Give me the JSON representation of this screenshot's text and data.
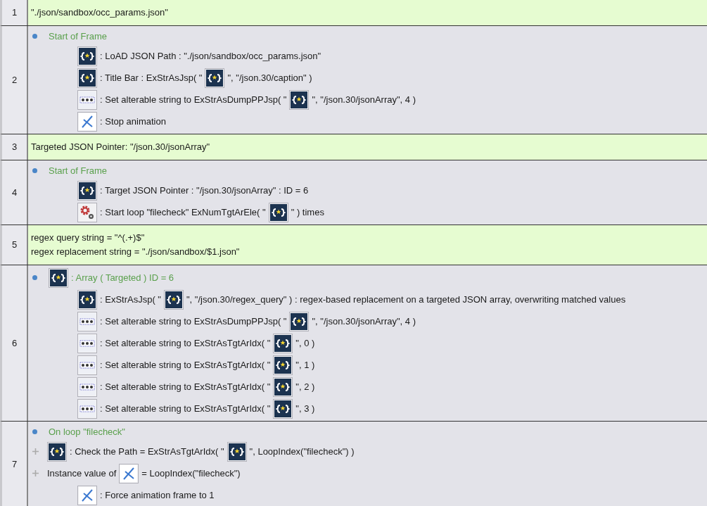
{
  "rows": [
    {
      "number": "1",
      "kind": "comment",
      "lines": [
        "\"./json/sandbox/occ_params.json\""
      ]
    },
    {
      "number": "2",
      "kind": "event",
      "conditions": [
        {
          "kind": "start",
          "segments": [
            {
              "text": "Start of Frame"
            }
          ]
        }
      ],
      "actions": [
        {
          "kind": "json",
          "segments": [
            {
              "text": ": LoAD JSON Path : \"./json/sandbox/occ_params.json\""
            }
          ]
        },
        {
          "kind": "json",
          "segments": [
            {
              "text": ": Title Bar : ExStrAsJsp( \""
            },
            {
              "kind": "json"
            },
            {
              "text": "\", \"/json.30/caption\" )"
            }
          ]
        },
        {
          "kind": "string",
          "segments": [
            {
              "text": ": Set alterable string to ExStrAsDumpPPJsp( \""
            },
            {
              "kind": "json"
            },
            {
              "text": "\", \"/json.30/jsonArray\", 4 )"
            }
          ]
        },
        {
          "kind": "animation",
          "segments": [
            {
              "text": ": Stop animation"
            }
          ]
        }
      ]
    },
    {
      "number": "3",
      "kind": "comment",
      "lines": [
        "Targeted JSON Pointer: \"/json.30/jsonArray\""
      ]
    },
    {
      "number": "4",
      "kind": "event",
      "conditions": [
        {
          "kind": "start",
          "segments": [
            {
              "text": "Start of Frame"
            }
          ]
        }
      ],
      "actions": [
        {
          "kind": "json",
          "segments": [
            {
              "text": ": Target JSON Pointer : \"/json.30/jsonArray\" : ID = 6"
            }
          ]
        },
        {
          "kind": "loop",
          "segments": [
            {
              "text": ": Start loop \"filecheck\" ExNumTgtArEle( \""
            },
            {
              "kind": "json"
            },
            {
              "text": "\" ) times"
            }
          ]
        }
      ]
    },
    {
      "number": "5",
      "kind": "comment",
      "lines": [
        "regex query string = \"^(.+)$\"",
        "regex replacement string = \"./json/sandbox/$1.json\""
      ]
    },
    {
      "number": "6",
      "kind": "event",
      "conditions": [
        {
          "kind": "start",
          "segments": [
            {
              "kind": "json"
            },
            {
              "text": ": Array ( Targeted ) ID = 6"
            }
          ]
        }
      ],
      "actions": [
        {
          "kind": "json",
          "segments": [
            {
              "text": ": ExStrAsJsp( \""
            },
            {
              "kind": "json"
            },
            {
              "text": "\", \"/json.30/regex_query\" ) : regex-based replacement on a targeted JSON array, overwriting matched values"
            }
          ]
        },
        {
          "kind": "string",
          "segments": [
            {
              "text": ": Set alterable string to ExStrAsDumpPPJsp( \""
            },
            {
              "kind": "json"
            },
            {
              "text": "\", \"/json.30/jsonArray\", 4 )"
            }
          ]
        },
        {
          "kind": "string",
          "segments": [
            {
              "text": ": Set alterable string to ExStrAsTgtArIdx( \""
            },
            {
              "kind": "json"
            },
            {
              "text": "\", 0 )"
            }
          ]
        },
        {
          "kind": "string",
          "segments": [
            {
              "text": ": Set alterable string to ExStrAsTgtArIdx( \""
            },
            {
              "kind": "json"
            },
            {
              "text": "\", 1 )"
            }
          ]
        },
        {
          "kind": "string",
          "segments": [
            {
              "text": ": Set alterable string to ExStrAsTgtArIdx( \""
            },
            {
              "kind": "json"
            },
            {
              "text": "\", 2 )"
            }
          ]
        },
        {
          "kind": "string",
          "segments": [
            {
              "text": ": Set alterable string to ExStrAsTgtArIdx( \""
            },
            {
              "kind": "json"
            },
            {
              "text": "\", 3 )"
            }
          ]
        }
      ]
    },
    {
      "number": "7",
      "kind": "event",
      "conditions": [
        {
          "kind": "start",
          "segments": [
            {
              "text": "On loop \"filecheck\""
            }
          ]
        },
        {
          "kind": "and",
          "segments": [
            {
              "kind": "json"
            },
            {
              "text": ": Check the Path = ExStrAsTgtArIdx( \""
            },
            {
              "kind": "json"
            },
            {
              "text": "\", LoopIndex(\"filecheck\") )"
            }
          ]
        },
        {
          "kind": "and",
          "segments": [
            {
              "text": "Instance value of"
            },
            {
              "kind": "animation"
            },
            {
              "text": "= LoopIndex(\"filecheck\")"
            }
          ]
        }
      ],
      "actions": [
        {
          "kind": "animation",
          "segments": [
            {
              "text": ": Force animation frame to 1"
            }
          ]
        }
      ]
    }
  ]
}
